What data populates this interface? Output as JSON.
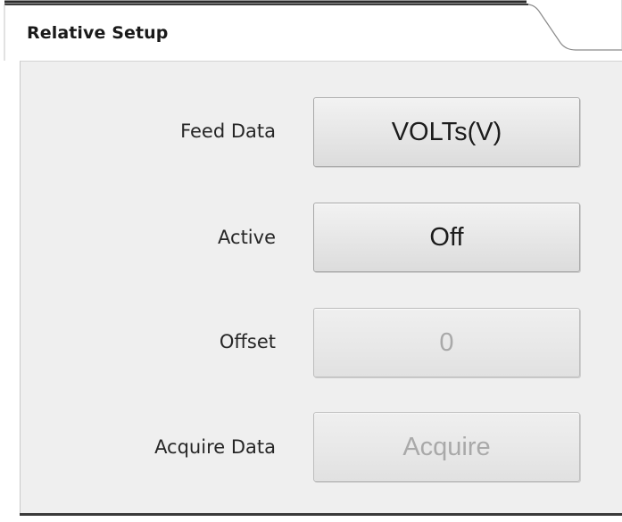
{
  "tab": {
    "title": "Relative Setup"
  },
  "rows": [
    {
      "label": "Feed Data",
      "value": "VOLTs(V)",
      "enabled": true
    },
    {
      "label": "Active",
      "value": "Off",
      "enabled": true
    },
    {
      "label": "Offset",
      "value": "0",
      "enabled": false
    },
    {
      "label": "Acquire Data",
      "value": "Acquire",
      "enabled": false
    }
  ],
  "colors": {
    "panel_background": "#efefef",
    "button_text": "#1c1c1c",
    "disabled_text": "#a9a9a9"
  }
}
